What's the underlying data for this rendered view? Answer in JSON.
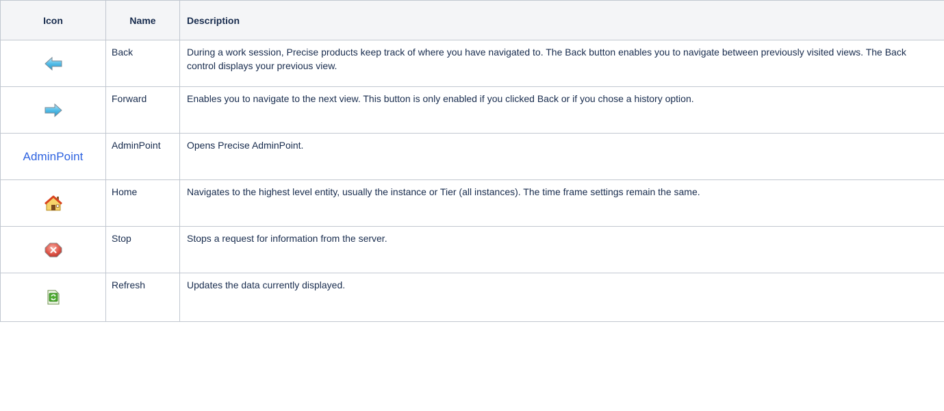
{
  "table": {
    "headers": {
      "icon": "Icon",
      "name": "Name",
      "description": "Description"
    },
    "rows": [
      {
        "icon": "back-arrow-icon",
        "name": "Back",
        "description": "During a work session, Precise products keep track of where you have navigated to. The Back button enables you to navigate between previously visited views. The Back control displays your previous view."
      },
      {
        "icon": "forward-arrow-icon",
        "name": "Forward",
        "description": "Enables you to navigate to the next view. This button is only enabled if you clicked Back or if you chose a history option."
      },
      {
        "icon": "adminpoint-logo",
        "icon_text": "AdminPoint",
        "name": "AdminPoint",
        "description": "Opens Precise AdminPoint."
      },
      {
        "icon": "home-icon",
        "name": "Home",
        "description": "Navigates to the highest level entity, usually the instance or Tier (all instances). The time frame settings remain the same."
      },
      {
        "icon": "stop-icon",
        "name": "Stop",
        "description": "Stops a request for information from the server."
      },
      {
        "icon": "refresh-icon",
        "name": "Refresh",
        "description": "Updates the data currently displayed."
      }
    ]
  },
  "colors": {
    "header_bg": "#f4f5f7",
    "border": "#c1c7d0",
    "text": "#172b4d",
    "adminpoint_blue": "#2d62e0"
  }
}
